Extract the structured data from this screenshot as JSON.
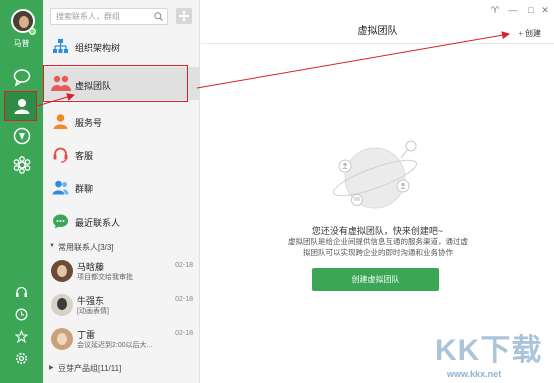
{
  "user": {
    "name": "马普"
  },
  "search": {
    "placeholder": "搜索联系人，群组"
  },
  "nav": [
    {
      "label": "组织架构树",
      "icon": "org-tree-icon",
      "color": "#2b8de0"
    },
    {
      "label": "虚拟团队",
      "icon": "virtual-team-icon",
      "color": "#e85a57"
    },
    {
      "label": "服务号",
      "icon": "service-account-icon",
      "color": "#f08a24"
    },
    {
      "label": "客服",
      "icon": "customer-service-icon",
      "color": "#e84c3d"
    },
    {
      "label": "群聊",
      "icon": "group-chat-icon",
      "color": "#2b8de0"
    },
    {
      "label": "最近联系人",
      "icon": "recent-contacts-icon",
      "color": "#3aa656"
    }
  ],
  "groups": {
    "frequent": {
      "label": "常用联系人[3/3]"
    },
    "product": {
      "label": "豆芽产品组[11/11]"
    }
  },
  "contacts": [
    {
      "name": "马晗藤",
      "message": "项目都交给我审批",
      "date": "02-18"
    },
    {
      "name": "牛强东",
      "message": "[动画表情]",
      "date": "02-18"
    },
    {
      "name": "丁雷",
      "message": "会议延迟到2:00以后大...",
      "date": "02-18"
    }
  ],
  "main": {
    "title": "虚拟团队",
    "create_label": "创建",
    "empty_title": "您还没有虚拟团队，快来创建吧~",
    "empty_desc": "虚拟团队是给企业间提供信息互通的服务渠道，通过虚拟团队可以实现跨企业的即时沟通和业务协作",
    "create_button": "创建虚拟团队"
  },
  "watermark": {
    "text": "KK下载",
    "url": "www.kkx.net"
  },
  "colors": {
    "accent": "#3aa656",
    "highlight": "#d9202a"
  }
}
